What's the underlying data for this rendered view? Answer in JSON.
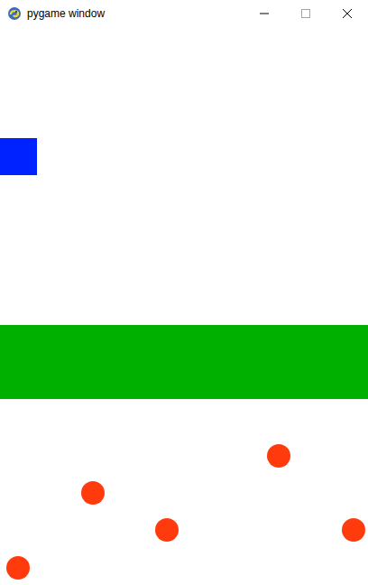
{
  "window": {
    "title": "pygame window"
  },
  "sprites": [
    {
      "kind": "player"
    },
    {
      "kind": "platform"
    },
    {
      "kind": "enemy"
    },
    {
      "kind": "enemy"
    },
    {
      "kind": "enemy"
    },
    {
      "kind": "enemy"
    },
    {
      "kind": "enemy"
    }
  ]
}
